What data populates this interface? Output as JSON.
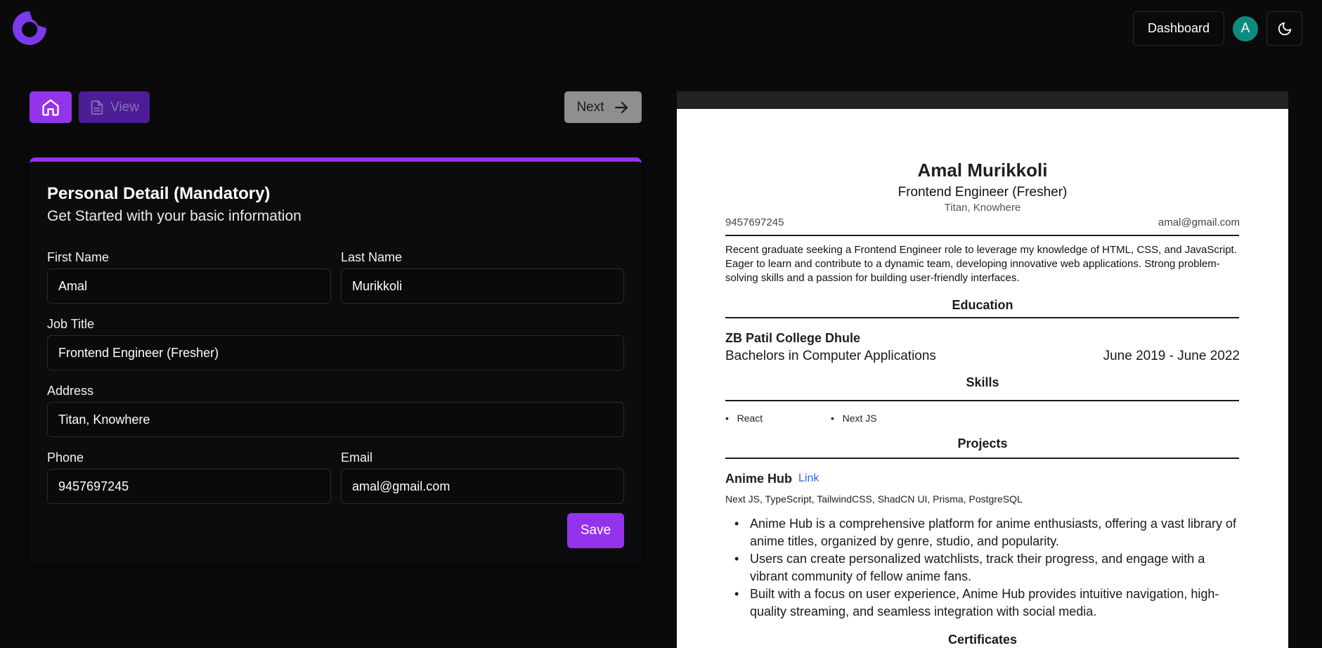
{
  "header": {
    "logo_icon": "brand-logo-icon",
    "dashboard_label": "Dashboard",
    "avatar_initial": "A",
    "theme_icon": "moon-icon"
  },
  "toolbar": {
    "home_icon": "home-icon",
    "view_label": "View",
    "view_icon": "document-icon",
    "next_label": "Next",
    "next_icon": "arrow-right-icon"
  },
  "form": {
    "title": "Personal Detail (Mandatory)",
    "subtitle": "Get Started with your basic information",
    "first_name": {
      "label": "First Name",
      "value": "Amal"
    },
    "last_name": {
      "label": "Last Name",
      "value": "Murikkoli"
    },
    "job_title": {
      "label": "Job Title",
      "value": "Frontend Engineer (Fresher)"
    },
    "address": {
      "label": "Address",
      "value": "Titan, Knowhere"
    },
    "phone": {
      "label": "Phone",
      "value": "9457697245"
    },
    "email": {
      "label": "Email",
      "value": "amal@gmail.com"
    },
    "save_label": "Save"
  },
  "resume": {
    "name": "Amal Murikkoli",
    "job_title": "Frontend Engineer (Fresher)",
    "address": "Titan, Knowhere",
    "phone": "9457697245",
    "email": "amal@gmail.com",
    "summary": "Recent graduate seeking a Frontend Engineer role to leverage my knowledge of HTML, CSS, and JavaScript. Eager to learn and contribute to a dynamic team, developing innovative web applications. Strong problem-solving skills and a passion for building user-friendly interfaces.",
    "education_heading": "Education",
    "education": {
      "school": "ZB Patil College Dhule",
      "degree": "Bachelors in Computer Applications",
      "dates": "June 2019 - June 2022"
    },
    "skills_heading": "Skills",
    "skills": [
      "React",
      "Next JS"
    ],
    "projects_heading": "Projects",
    "project": {
      "name": "Anime Hub",
      "link_label": "Link",
      "tech": "Next JS, TypeScript, TailwindCSS, ShadCN UI, Prisma, PostgreSQL",
      "bullets": [
        "Anime Hub is a comprehensive platform for anime enthusiasts, offering a vast library of anime titles, organized by genre, studio, and popularity.",
        "Users can create personalized watchlists, track their progress, and engage with a vibrant community of fellow anime fans.",
        "Built with a focus on user experience, Anime Hub provides intuitive navigation, high-quality streaming, and seamless integration with social media."
      ]
    },
    "certificates_heading": "Certificates"
  },
  "colors": {
    "accent": "#9333ea",
    "background": "#0a0a0b",
    "avatar": "#0f8a7e",
    "link": "#2563eb"
  }
}
